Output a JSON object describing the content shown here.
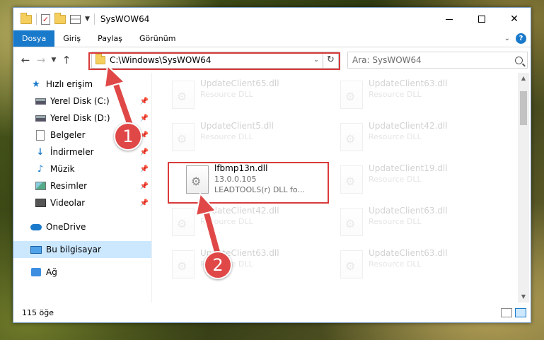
{
  "window": {
    "title": "SysWOW64"
  },
  "ribbon": {
    "tabs": [
      {
        "label": "Dosya",
        "active": true
      },
      {
        "label": "Giriş",
        "active": false
      },
      {
        "label": "Paylaş",
        "active": false
      },
      {
        "label": "Görünüm",
        "active": false
      }
    ],
    "help_label": "?"
  },
  "nav": {
    "address": "C:\\Windows\\SysWOW64",
    "search_placeholder": "Ara: SysWOW64"
  },
  "sidebar": {
    "items": [
      {
        "label": "Hızlı erişim",
        "icon": "star-icon"
      },
      {
        "label": "Yerel Disk (C:)",
        "icon": "drive-icon",
        "pinned": true
      },
      {
        "label": "Yerel Disk (D:)",
        "icon": "drive-icon",
        "pinned": true
      },
      {
        "label": "Belgeler",
        "icon": "document-icon",
        "pinned": true
      },
      {
        "label": "İndirmeler",
        "icon": "download-icon",
        "pinned": true
      },
      {
        "label": "Müzik",
        "icon": "music-icon",
        "pinned": true
      },
      {
        "label": "Resimler",
        "icon": "pictures-icon",
        "pinned": true
      },
      {
        "label": "Videolar",
        "icon": "videos-icon",
        "pinned": true
      },
      {
        "label": "OneDrive",
        "icon": "cloud-icon"
      },
      {
        "label": "Bu bilgisayar",
        "icon": "computer-icon",
        "selected": true
      },
      {
        "label": "Ağ",
        "icon": "network-icon"
      }
    ]
  },
  "files": [
    {
      "name": "UpdateClient65.dll",
      "desc": "Resource DLL",
      "faded": true
    },
    {
      "name": "UpdateClient63.dll",
      "desc": "Resource DLL",
      "faded": true
    },
    {
      "name": "UpdateClient5.dll",
      "desc": "Resource DLL",
      "faded": true
    },
    {
      "name": "UpdateClient42.dll",
      "desc": "Resource DLL",
      "faded": true
    },
    {
      "name": "lfbmp13n.dll",
      "version": "13.0.0.105",
      "desc": "LEADTOOLS(r) DLL fo...",
      "faded": false
    },
    {
      "name": "UpdateClient19.dll",
      "desc": "Resource DLL",
      "faded": true
    },
    {
      "name": "UpdateClient42.dll",
      "desc": "Resource DLL",
      "faded": true
    },
    {
      "name": "UpdateClient63.dll",
      "desc": "Resource DLL",
      "faded": true
    },
    {
      "name": "UpdateClient63.dll",
      "desc": "Resource DLL",
      "faded": true
    },
    {
      "name": "UpdateClient63.dll",
      "desc": "Resource DLL",
      "faded": true
    }
  ],
  "status": {
    "count": "115 öğe"
  },
  "callouts": {
    "one": "1",
    "two": "2"
  },
  "colors": {
    "accent": "#1979ca",
    "highlight": "#d93a3a",
    "selection": "#cce8ff"
  }
}
